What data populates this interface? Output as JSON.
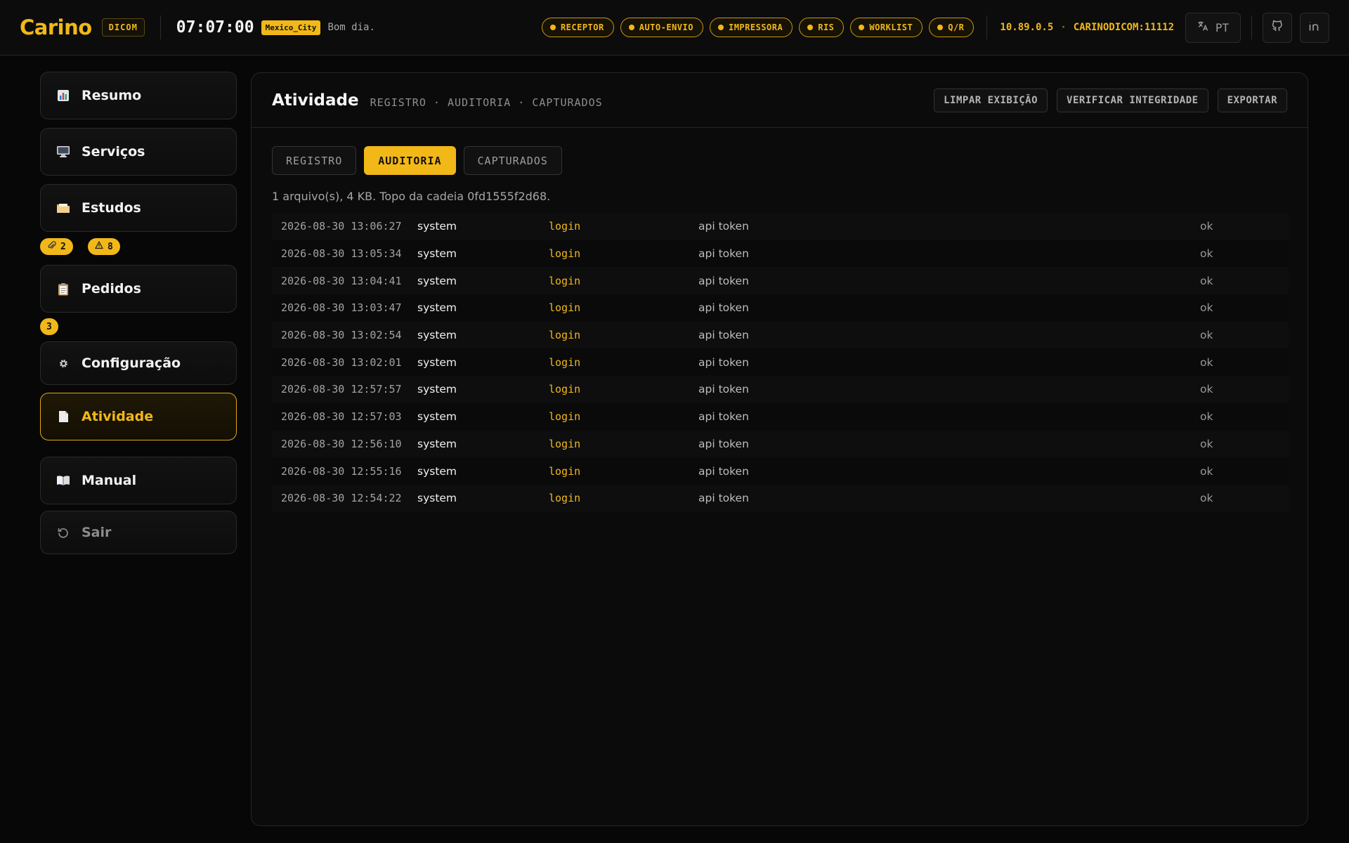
{
  "header": {
    "brand": "Carino",
    "brand_tag": "DICOM",
    "clock": "07:07:00",
    "timezone": "Mexico_City",
    "greeting": "Bom dia.",
    "status_pills": [
      "RECEPTOR",
      "AUTO-ENVIO",
      "IMPRESSORA",
      "RIS",
      "WORKLIST",
      "Q/R"
    ],
    "ip": "10.89.0.5",
    "ae_port": "CARINODICOM:11112",
    "language": "PT"
  },
  "sidebar": {
    "items": [
      {
        "label": "Resumo",
        "icon": "bar-chart-icon"
      },
      {
        "label": "Serviços",
        "icon": "monitor-icon"
      },
      {
        "label": "Estudos",
        "icon": "folder-icon"
      },
      {
        "label": "Pedidos",
        "icon": "clipboard-icon"
      },
      {
        "label": "Configuração",
        "icon": "gear-icon"
      },
      {
        "label": "Atividade",
        "icon": "document-icon"
      },
      {
        "label": "Manual",
        "icon": "book-icon"
      },
      {
        "label": "Sair",
        "icon": "logout-icon"
      }
    ],
    "estudos_badges": [
      "2",
      "8"
    ],
    "pedidos_badge": "3"
  },
  "main": {
    "title": "Atividade",
    "subtitle": "REGISTRO · AUDITORIA · CAPTURADOS",
    "actions": [
      "LIMPAR EXIBIÇÃO",
      "VERIFICAR INTEGRIDADE",
      "EXPORTAR"
    ],
    "tabs": [
      "REGISTRO",
      "AUDITORIA",
      "CAPTURADOS"
    ],
    "active_tab": "AUDITORIA",
    "summary": "1 arquivo(s), 4 KB. Topo da cadeia 0fd1555f2d68.",
    "rows": [
      {
        "time": "2026-08-30 13:06:27",
        "actor": "system",
        "action": "login",
        "detail": "api token",
        "status": "ok"
      },
      {
        "time": "2026-08-30 13:05:34",
        "actor": "system",
        "action": "login",
        "detail": "api token",
        "status": "ok"
      },
      {
        "time": "2026-08-30 13:04:41",
        "actor": "system",
        "action": "login",
        "detail": "api token",
        "status": "ok"
      },
      {
        "time": "2026-08-30 13:03:47",
        "actor": "system",
        "action": "login",
        "detail": "api token",
        "status": "ok"
      },
      {
        "time": "2026-08-30 13:02:54",
        "actor": "system",
        "action": "login",
        "detail": "api token",
        "status": "ok"
      },
      {
        "time": "2026-08-30 13:02:01",
        "actor": "system",
        "action": "login",
        "detail": "api token",
        "status": "ok"
      },
      {
        "time": "2026-08-30 12:57:57",
        "actor": "system",
        "action": "login",
        "detail": "api token",
        "status": "ok"
      },
      {
        "time": "2026-08-30 12:57:03",
        "actor": "system",
        "action": "login",
        "detail": "api token",
        "status": "ok"
      },
      {
        "time": "2026-08-30 12:56:10",
        "actor": "system",
        "action": "login",
        "detail": "api token",
        "status": "ok"
      },
      {
        "time": "2026-08-30 12:55:16",
        "actor": "system",
        "action": "login",
        "detail": "api token",
        "status": "ok"
      },
      {
        "time": "2026-08-30 12:54:22",
        "actor": "system",
        "action": "login",
        "detail": "api token",
        "status": "ok"
      }
    ]
  },
  "colors": {
    "accent": "#f2b818",
    "background": "#070707",
    "panel": "#0b0b0b"
  }
}
